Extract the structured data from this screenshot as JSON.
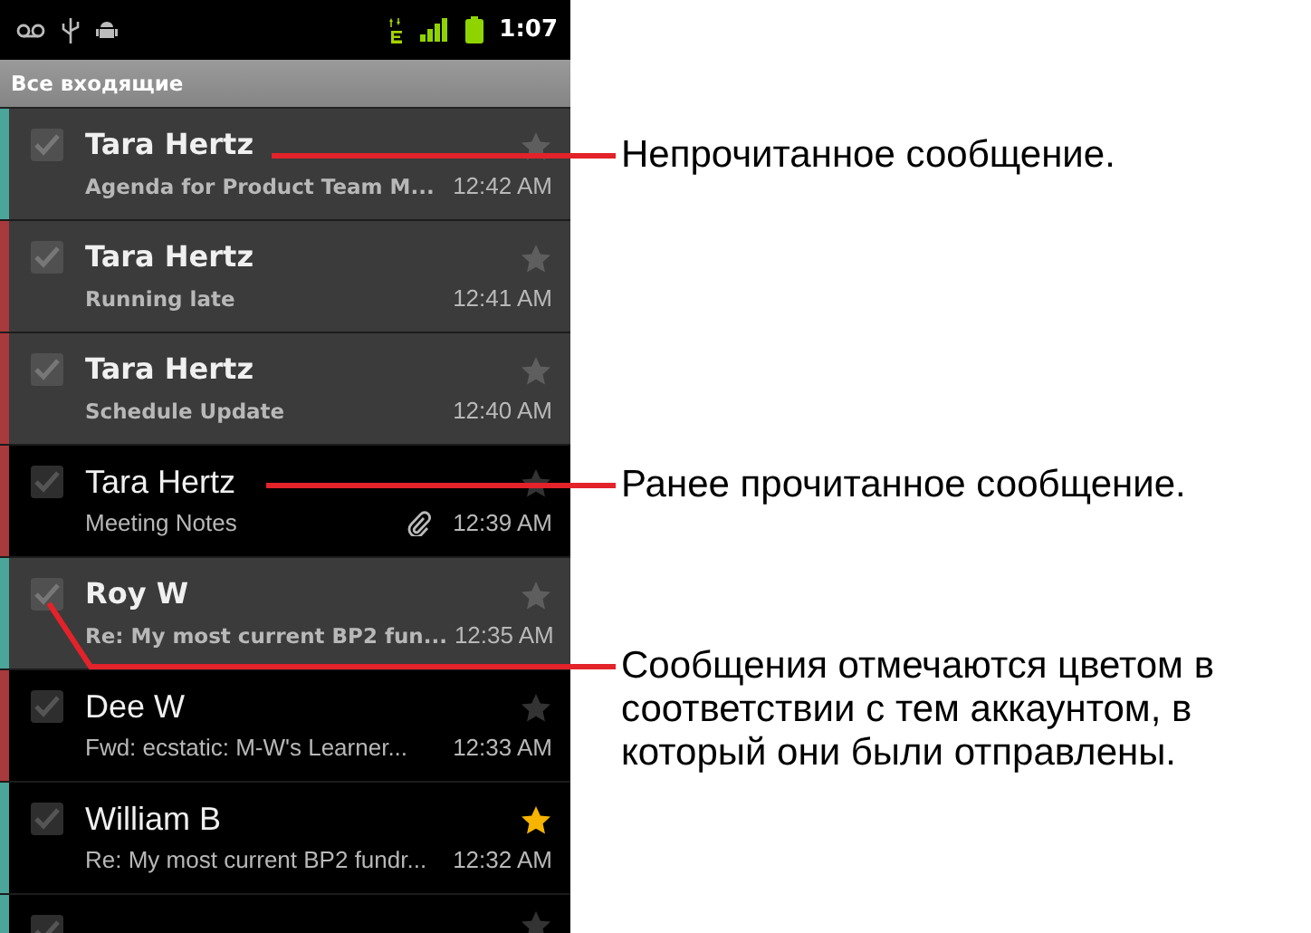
{
  "status_bar": {
    "time": "1:07"
  },
  "title": "Все входящие",
  "messages": [
    {
      "sender": "Tara Hertz",
      "subject": "Agenda for Product Team M...",
      "time": "12:42 AM",
      "unread": true,
      "starred": false,
      "attachment": false,
      "checked": false,
      "color": "#4aa59a"
    },
    {
      "sender": "Tara Hertz",
      "subject": "Running late",
      "time": "12:41 AM",
      "unread": true,
      "starred": false,
      "attachment": false,
      "checked": false,
      "color": "#a8393c"
    },
    {
      "sender": "Tara Hertz",
      "subject": "Schedule Update",
      "time": "12:40 AM",
      "unread": true,
      "starred": false,
      "attachment": false,
      "checked": false,
      "color": "#a8393c"
    },
    {
      "sender": "Tara Hertz",
      "subject": "Meeting Notes",
      "time": "12:39 AM",
      "unread": false,
      "starred": false,
      "attachment": true,
      "checked": false,
      "color": "#a8393c"
    },
    {
      "sender": "Roy W",
      "subject": "Re: My most current BP2 fun...",
      "time": "12:35 AM",
      "unread": true,
      "starred": false,
      "attachment": false,
      "checked": false,
      "color": "#4aa59a"
    },
    {
      "sender": "Dee W",
      "subject": "Fwd: ecstatic: M-W's Learner...",
      "time": "12:33 AM",
      "unread": false,
      "starred": false,
      "attachment": false,
      "checked": false,
      "color": "#a8393c"
    },
    {
      "sender": "William B",
      "subject": "Re: My most current BP2 fundr...",
      "time": "12:32 AM",
      "unread": false,
      "starred": true,
      "attachment": false,
      "checked": false,
      "color": "#4aa59a"
    }
  ],
  "partial_message": {
    "starred": false,
    "checked": false,
    "color": "#4aa59a"
  },
  "callouts": [
    {
      "text": "Непрочитанное сообщение."
    },
    {
      "text": "Ранее прочитанное сообщение."
    },
    {
      "text": "Сообщения отмечаются цветом в соответствии с тем аккаунтом, в который они были отправлены."
    }
  ]
}
